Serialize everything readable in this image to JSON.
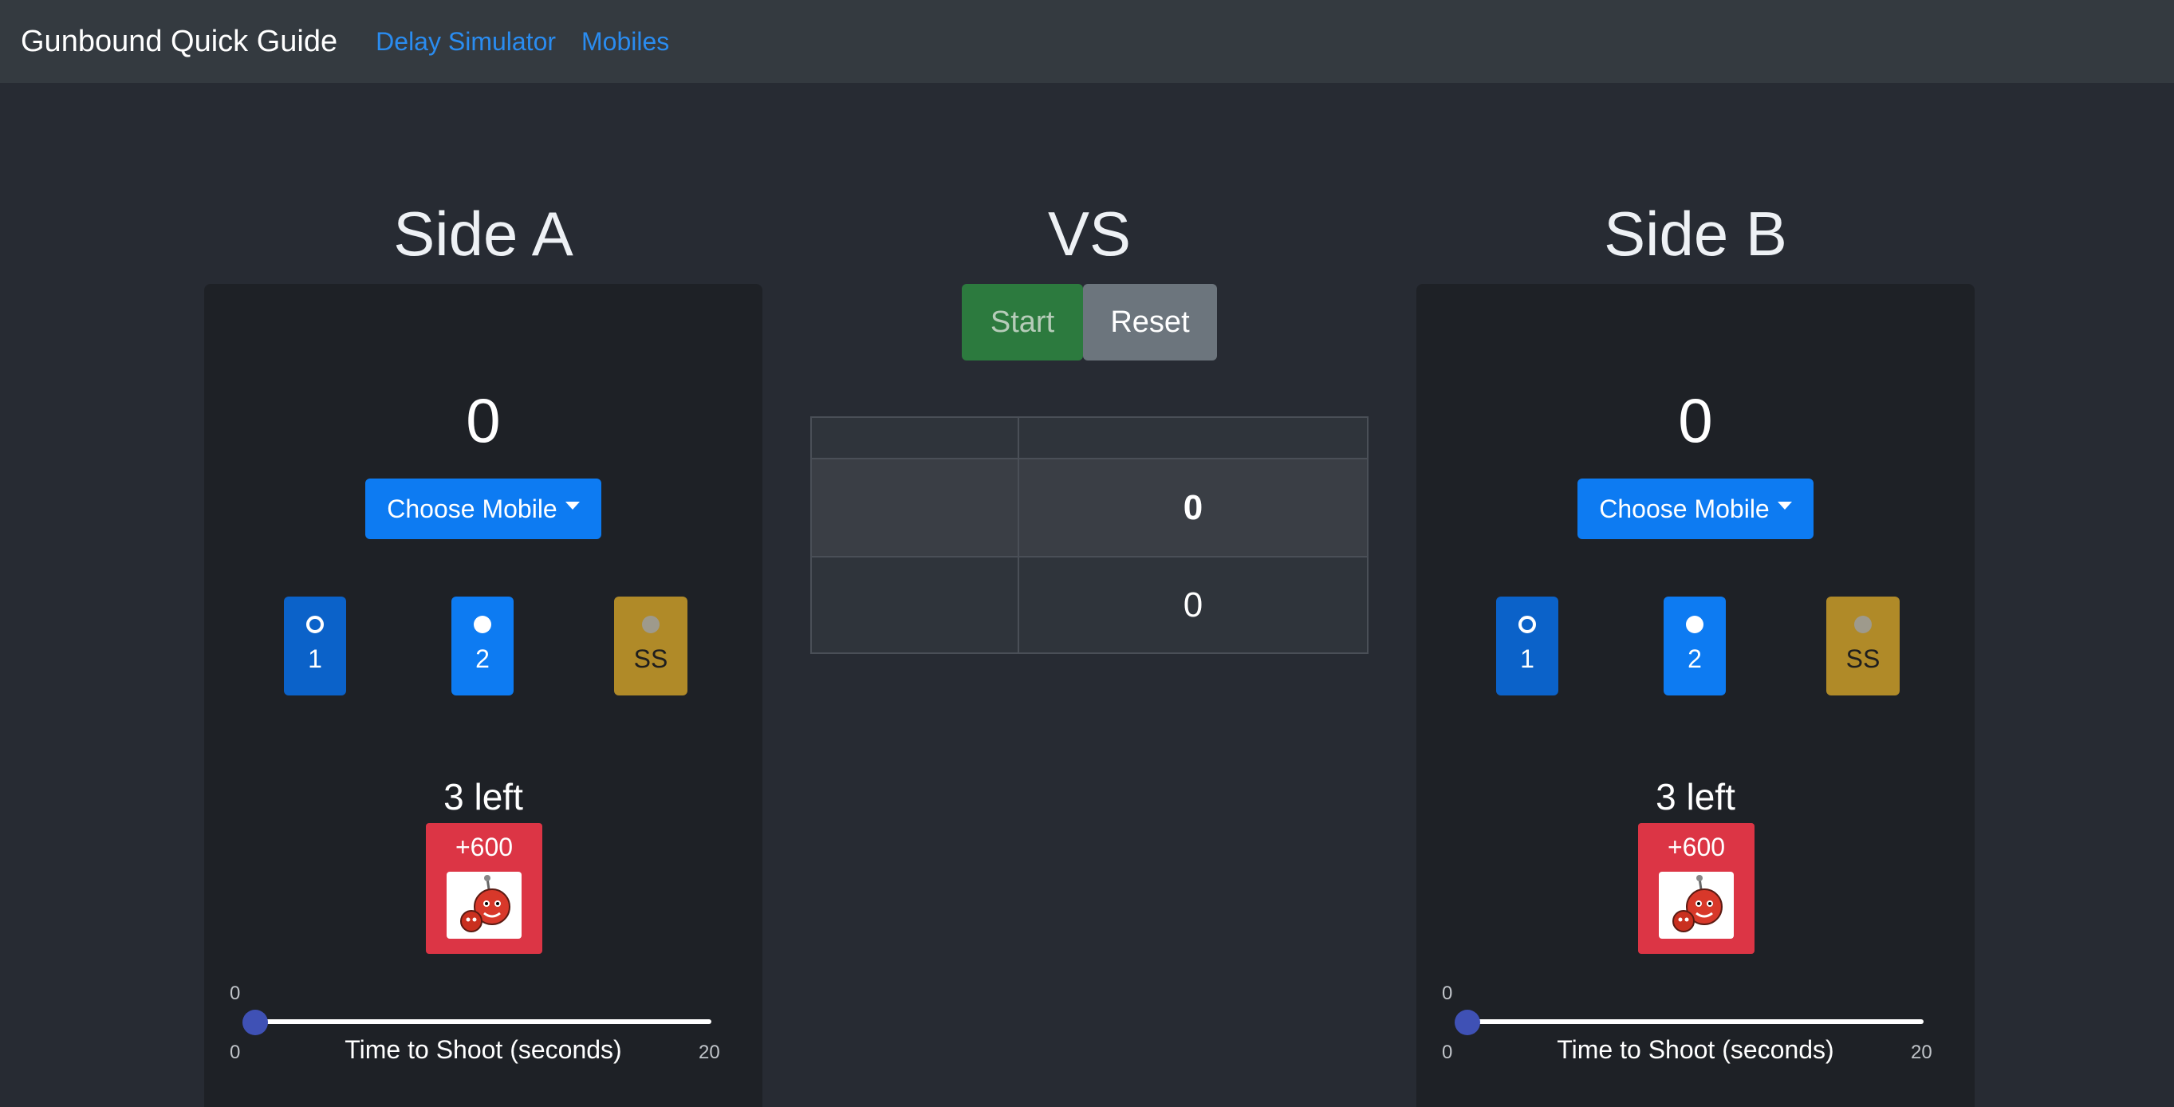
{
  "navbar": {
    "brand": "Gunbound Quick Guide",
    "links": [
      "Delay Simulator",
      "Mobiles"
    ]
  },
  "side_a": {
    "title": "Side A",
    "score": "0",
    "choose_label": "Choose Mobile",
    "slots": [
      "1",
      "2",
      "SS"
    ],
    "selected_slot": "2",
    "left_text": "3 left",
    "item_value": "+600",
    "slider": {
      "value": "0",
      "min": "0",
      "max": "20",
      "label": "Time to Shoot (seconds)",
      "fraction": 0.0
    }
  },
  "center": {
    "vs": "VS",
    "start_label": "Start",
    "reset_label": "Reset",
    "table": {
      "header": [
        "",
        ""
      ],
      "rows": [
        [
          "",
          "0"
        ],
        [
          "",
          "0"
        ]
      ]
    }
  },
  "side_b": {
    "title": "Side B",
    "score": "0",
    "choose_label": "Choose Mobile",
    "slots": [
      "1",
      "2",
      "SS"
    ],
    "selected_slot": "2",
    "left_text": "3 left",
    "item_value": "+600",
    "slider": {
      "value": "0",
      "min": "0",
      "max": "20",
      "label": "Time to Shoot (seconds)",
      "fraction": 0.0
    }
  },
  "colors": {
    "background": "#272b33",
    "navbar": "#343a40",
    "panel": "#1e2126",
    "primary": "#0d7bf2",
    "success": "#2c7a3e",
    "secondary": "#6c757d",
    "warning": "#b08a28",
    "danger": "#dc3545",
    "slider_thumb": "#3f51b5"
  },
  "icons": {
    "item": "red-bomb-creature-icon"
  }
}
